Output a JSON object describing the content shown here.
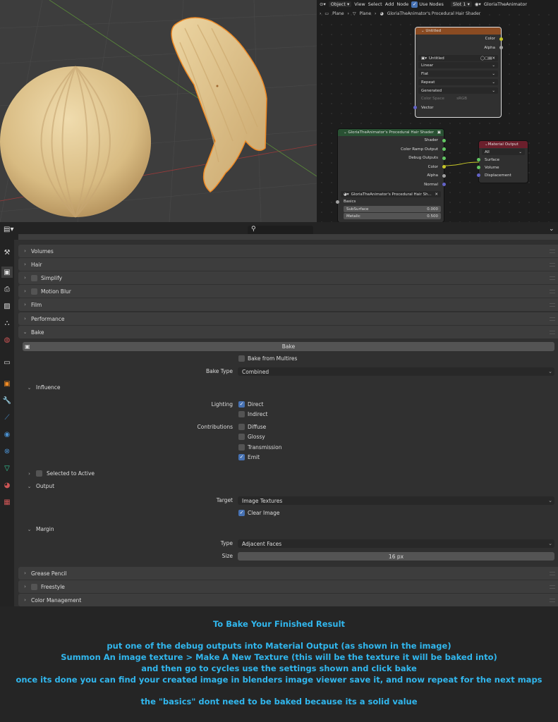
{
  "node_editor": {
    "header": {
      "mode": "Object",
      "menus": [
        "View",
        "Select",
        "Add",
        "Node"
      ],
      "use_nodes": "Use Nodes",
      "slot": "Slot 1",
      "material": "GloriaTheAnimator"
    },
    "breadcrumb": [
      "Plane",
      "Plane",
      "GloriaTheAnimator's Procedural Hair Shader"
    ],
    "image_node": {
      "title": "Untitled",
      "outputs": [
        "Color",
        "Alpha"
      ],
      "image_name": "Untitled",
      "interpolation": "Linear",
      "projection": "Flat",
      "extension": "Repeat",
      "source": "Generated",
      "color_space_label": "Color Space",
      "color_space": "sRGB",
      "input": "Vector"
    },
    "group_node": {
      "title": "GloriaTheAnimator's Procedural Hair Shader",
      "outputs": [
        "Shader",
        "Color Ramp Output",
        "Debug Outputs",
        "Color",
        "Alpha",
        "Normal"
      ],
      "group_name": "GloriaTheAnimator's Procedural Hair Sh...",
      "section": "Basics",
      "sliders": [
        {
          "label": "SubSurface",
          "value": "0.000"
        },
        {
          "label": "Metalic",
          "value": "0.500"
        }
      ]
    },
    "output_node": {
      "title": "Material Output",
      "target": "All",
      "inputs": [
        "Surface",
        "Volume",
        "Displacement"
      ]
    }
  },
  "properties": {
    "panels_top": [
      {
        "label": "Volumes",
        "checkbox": false
      },
      {
        "label": "Hair",
        "checkbox": false
      },
      {
        "label": "Simplify",
        "checkbox": true
      },
      {
        "label": "Motion Blur",
        "checkbox": true
      },
      {
        "label": "Film",
        "checkbox": false
      },
      {
        "label": "Performance",
        "checkbox": false
      }
    ],
    "bake_panel": "Bake",
    "bake_button": "Bake",
    "bake_from_multires": "Bake from Multires",
    "bake_type_label": "Bake Type",
    "bake_type": "Combined",
    "influence": "Influence",
    "lighting_label": "Lighting",
    "direct": "Direct",
    "indirect": "Indirect",
    "contributions_label": "Contributions",
    "diffuse": "Diffuse",
    "glossy": "Glossy",
    "transmission": "Transmission",
    "emit": "Emit",
    "selected_to_active": "Selected to Active",
    "output": "Output",
    "target_label": "Target",
    "target": "Image Textures",
    "clear_image": "Clear Image",
    "margin": "Margin",
    "type_label": "Type",
    "type": "Adjacent Faces",
    "size_label": "Size",
    "size": "16 px",
    "panels_bottom": [
      {
        "label": "Grease Pencil",
        "checkbox": false
      },
      {
        "label": "Freestyle",
        "checkbox": true
      },
      {
        "label": "Color Management",
        "checkbox": false
      }
    ]
  },
  "instructions": {
    "title": "To Bake Your Finished Result",
    "lines": [
      "put one of the debug outputs into Material Output (as shown in the image)",
      "Summon An image texture > Make A New Texture (this will be the texture it will be baked into)",
      "and then go to cycles use the settings shown and click bake",
      "once its done you can find your created image in blenders image viewer save it, and now repeat for the next maps"
    ],
    "note": "the \"basics\" dont need to be baked because its a solid value"
  },
  "colors": {
    "accent": "#4772b3",
    "instruction_text": "#31b7ee",
    "selection": "#f08a24",
    "image_node_header": "#8a4b22",
    "group_node_header": "#295133",
    "output_node_header": "#6b1f2c"
  }
}
